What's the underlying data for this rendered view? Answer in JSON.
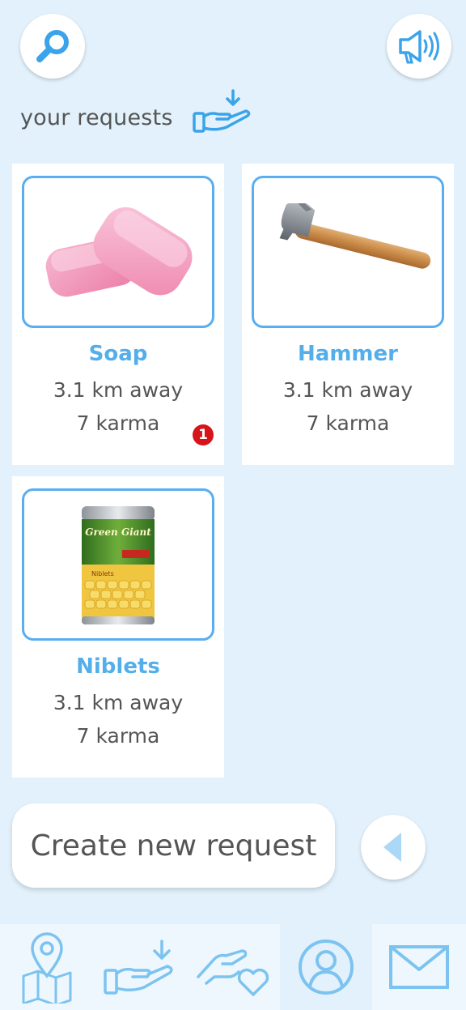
{
  "header": {
    "search_icon": "search-icon",
    "speaker_icon": "speaker-icon"
  },
  "section": {
    "title": "your requests",
    "icon": "receive-hand-icon"
  },
  "requests": [
    {
      "name": "Soap",
      "distance": "3.1 km away",
      "karma": "7 karma",
      "badge": "1",
      "image": "soap-image"
    },
    {
      "name": "Hammer",
      "distance": "3.1 km away",
      "karma": "7 karma",
      "image": "hammer-image"
    },
    {
      "name": "Niblets",
      "distance": "3.1 km away",
      "karma": "7 karma",
      "image": "corn-can-image",
      "can_text": {
        "brand": "Green Giant",
        "product": "Niblets"
      }
    }
  ],
  "actions": {
    "create_label": "Create new request",
    "back_icon": "triangle-left-icon"
  },
  "tabbar": {
    "tabs": [
      "map-tab",
      "requests-tab",
      "offers-tab",
      "profile-tab",
      "messages-tab"
    ],
    "active": "profile-tab"
  },
  "colors": {
    "background": "#e2f1fb",
    "accent": "#53aee9",
    "badge": "#d7141a",
    "text": "#555555"
  }
}
